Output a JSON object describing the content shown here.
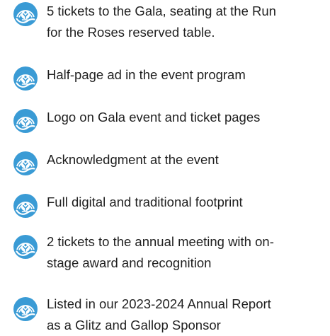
{
  "colors": {
    "icon_primary": "#3a9bd5",
    "icon_light": "#e8f4fb",
    "text": "#1f1f1f"
  },
  "icon": "united-way-logo-icon",
  "benefits": [
    {
      "text": "5 tickets to the Gala, seating at the Run\nfor the Roses reserved table."
    },
    {
      "text": "Half-page ad in the event program"
    },
    {
      "text": "Logo on Gala event and ticket pages"
    },
    {
      "text": "Acknowledgment at the event"
    },
    {
      "text": "Full digital and traditional footprint"
    },
    {
      "text": "2 tickets to the annual meeting with on-\nstage award and recognition"
    },
    {
      "text": "Listed in our 2023-2024 Annual Report\nas a Glitz and Gallop Sponsor"
    }
  ]
}
